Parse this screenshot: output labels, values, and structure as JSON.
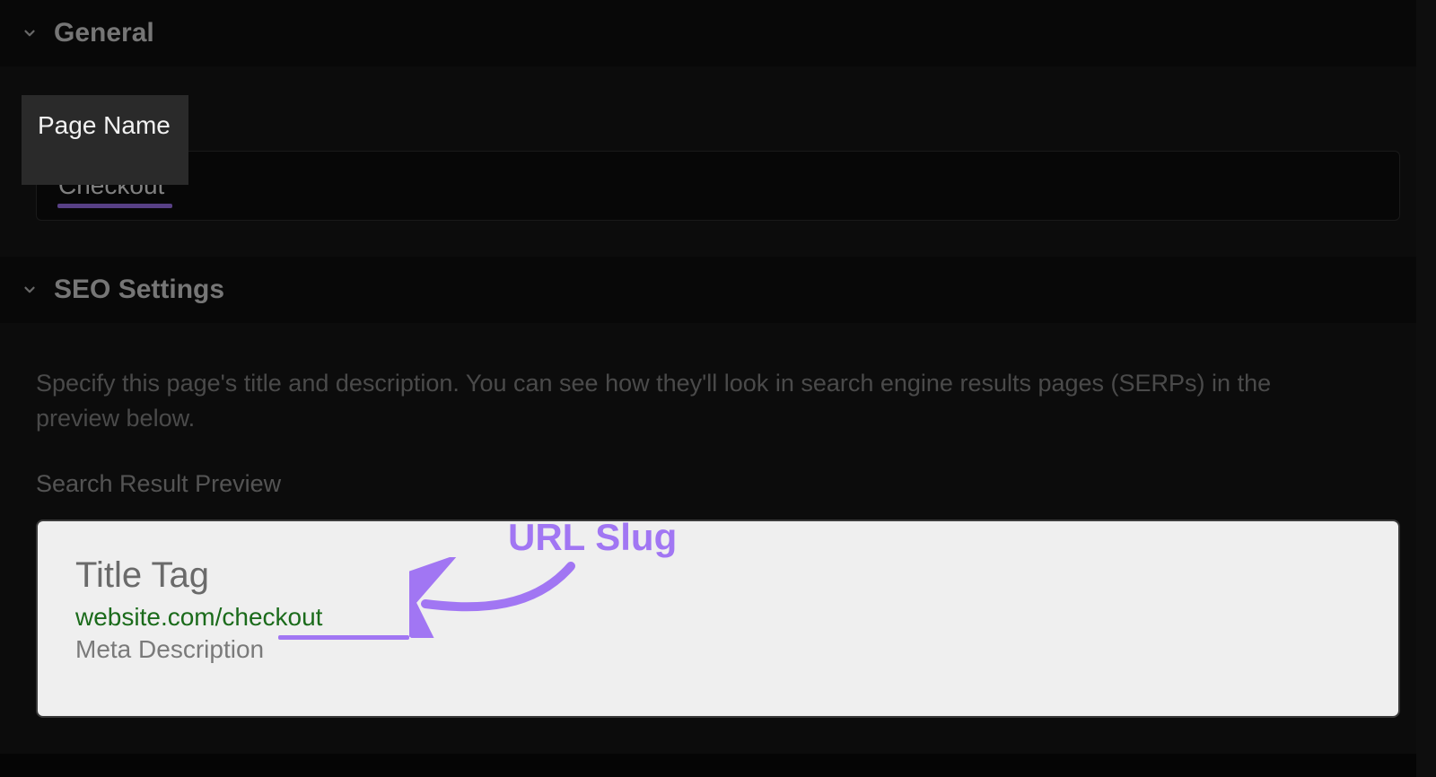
{
  "sections": {
    "general": {
      "title": "General",
      "fields": {
        "page_name": {
          "label": "Page Name",
          "value": "Checkout"
        }
      }
    },
    "seo": {
      "title": "SEO Settings",
      "description": "Specify this page's title and description. You can see how they'll look in search engine results pages (SERPs) in the preview below.",
      "preview_label": "Search Result Preview",
      "serp": {
        "title_tag": "Title Tag",
        "url": "website.com/checkout",
        "meta_description": "Meta Description"
      }
    }
  },
  "annotation": {
    "label": "URL Slug"
  },
  "colors": {
    "accent": "#a176f3",
    "serp_url_green": "#1b6b1b"
  }
}
